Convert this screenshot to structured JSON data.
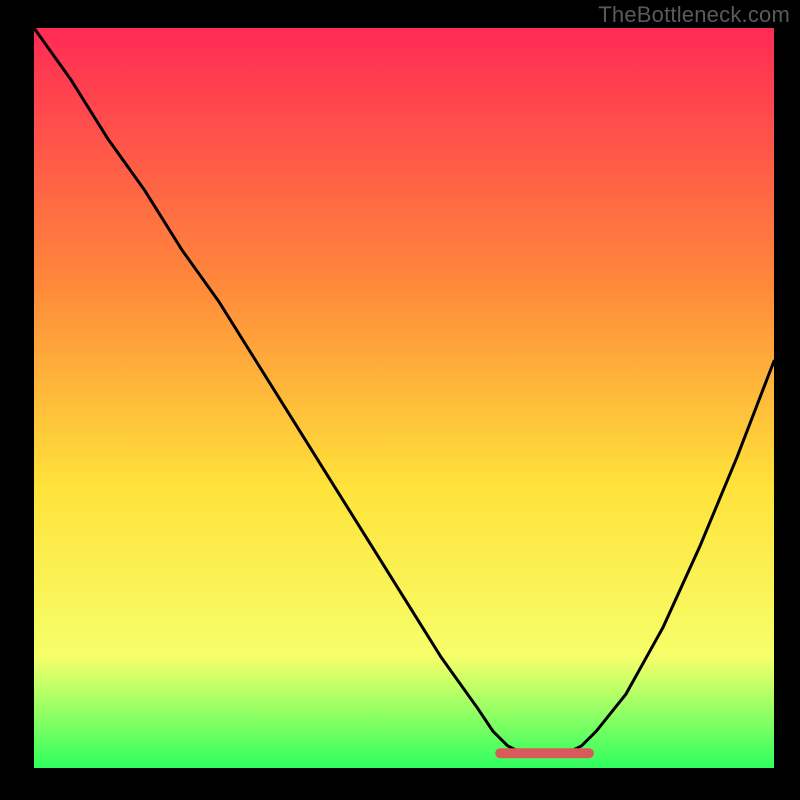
{
  "watermark": "TheBottleneck.com",
  "colors": {
    "gradient_top": "#ff2a55",
    "gradient_mid1": "#ff8a3a",
    "gradient_mid2": "#ffe23a",
    "gradient_mid3": "#f6ff6a",
    "gradient_bottom": "#2eff5e",
    "curve": "#000000",
    "marker": "#d85a5a",
    "outer": "#000000"
  },
  "chart_data": {
    "type": "line",
    "title": "",
    "xlabel": "",
    "ylabel": "",
    "xlim": [
      0,
      100
    ],
    "ylim": [
      0,
      100
    ],
    "x": [
      0,
      5,
      10,
      15,
      20,
      25,
      30,
      35,
      40,
      45,
      50,
      55,
      60,
      62,
      64,
      66,
      68,
      70,
      72,
      74,
      76,
      80,
      85,
      90,
      95,
      100
    ],
    "values": [
      100,
      93,
      85,
      78,
      70,
      63,
      55,
      47,
      39,
      31,
      23,
      15,
      8,
      5,
      3,
      2,
      2,
      2,
      2,
      3,
      5,
      10,
      19,
      30,
      42,
      55
    ],
    "flat_region_x": [
      63,
      75
    ],
    "flat_region_y": 2,
    "grid": false,
    "notes": "Single V-shaped bottleneck curve on rainbow gradient; red flat segment marks near-zero bottleneck region."
  }
}
